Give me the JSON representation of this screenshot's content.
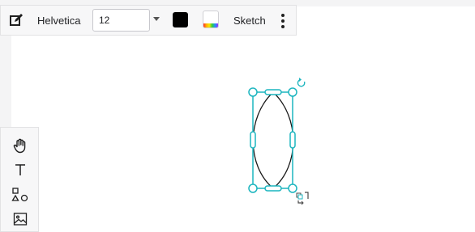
{
  "toolbar": {
    "edit_icon": "edit-pencil-icon",
    "font_family": "Helvetica",
    "font_size": "12",
    "stroke_color": "#000000",
    "fill_icon": "fill-color-icon",
    "style_label": "Sketch",
    "more_icon": "more-vertical-icon"
  },
  "side_tools": [
    {
      "name": "hand-icon"
    },
    {
      "name": "text-icon"
    },
    {
      "name": "shapes-icon"
    },
    {
      "name": "image-icon"
    }
  ],
  "selection": {
    "shape": "ellipse",
    "accent": "#1cb5bf"
  }
}
